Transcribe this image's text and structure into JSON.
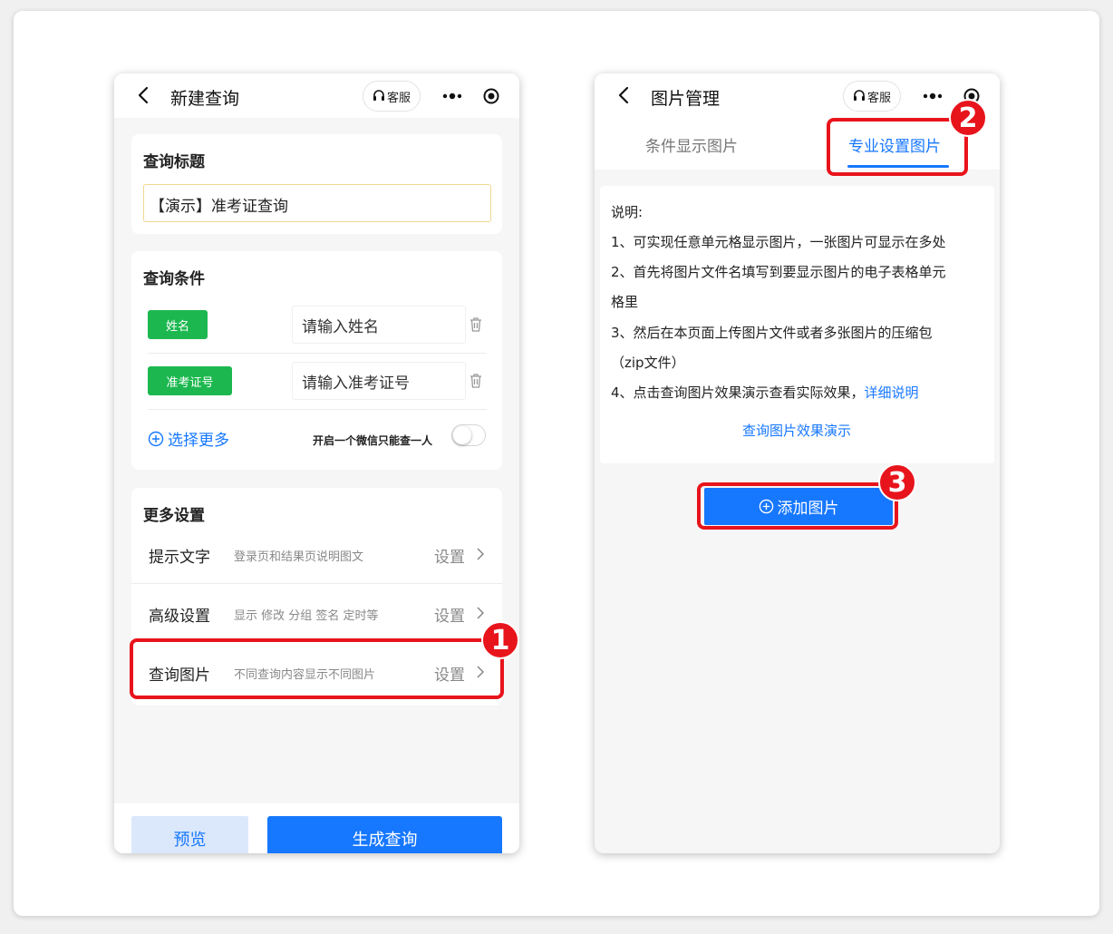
{
  "left_phone": {
    "nav": {
      "title": "新建查询",
      "service_label": "客服"
    },
    "title_section": {
      "label": "查询标题",
      "input_value": "【演示】准考证查询"
    },
    "conditions": {
      "label": "查询条件",
      "rows": [
        {
          "tag": "姓名",
          "placeholder": "请输入姓名"
        },
        {
          "tag": "准考证号",
          "placeholder": "请输入准考证号"
        }
      ],
      "more_label": "选择更多",
      "toggle_label": "开启一个微信只能查一人"
    },
    "more_settings": {
      "label": "更多设置",
      "rows": [
        {
          "name": "提示文字",
          "desc": "登录页和结果页说明图文",
          "action": "设置"
        },
        {
          "name": "高级设置",
          "desc": "显示 修改 分组 签名 定时等",
          "action": "设置"
        },
        {
          "name": "查询图片",
          "desc": "不同查询内容显示不同图片",
          "action": "设置"
        }
      ]
    },
    "buttons": {
      "preview": "预览",
      "generate": "生成查询"
    }
  },
  "right_phone": {
    "nav": {
      "title": "图片管理",
      "service_label": "客服"
    },
    "tabs": [
      {
        "label": "条件显示图片",
        "active": false
      },
      {
        "label": "专业设置图片",
        "active": true
      }
    ],
    "notes": {
      "heading": "说明:",
      "line1": "1、可实现任意单元格显示图片，一张图片可显示在多处",
      "line2a": "2、首先将图片文件名填写到要显示图片的电子表格单元",
      "line2b": "格里",
      "line3a": "3、然后在本页面上传图片文件或者多张图片的压缩包",
      "line3b": "（zip文件）",
      "line4": "4、点击查询图片效果演示查看实际效果，",
      "line4_link": "详细说明",
      "demo_link": "查询图片效果演示"
    },
    "add_button": "添加图片"
  },
  "annotations": {
    "badge1": "1",
    "badge2": "2",
    "badge3": "3"
  },
  "colors": {
    "accent": "#1677ff",
    "tag_green": "#1cb84f",
    "highlight_red": "#e8141c"
  }
}
